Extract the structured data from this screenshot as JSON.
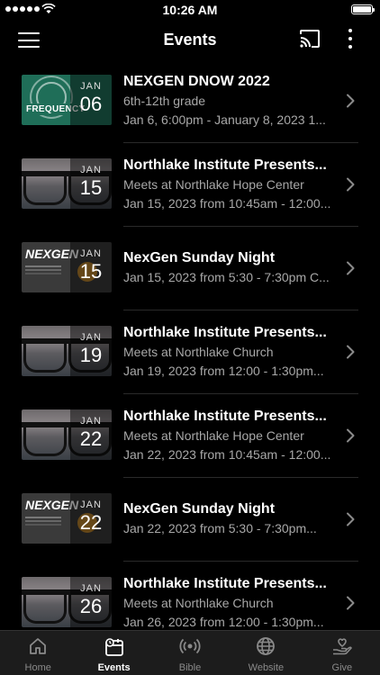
{
  "status_bar": {
    "time": "10:26 AM"
  },
  "header": {
    "title": "Events"
  },
  "events": [
    {
      "name": "NEXGEN DNOW 2022",
      "line1": "6th-12th grade",
      "line2": "Jan 6, 6:00pm - January 8, 2023 1...",
      "month": "JAN",
      "day": "06",
      "art": "frequency",
      "art_text": "FREQUENCY"
    },
    {
      "name": "Northlake Institute Presents...",
      "line1": "Meets at Northlake Hope Center",
      "line2": "Jan 15, 2023 from 10:45am - 12:00...",
      "month": "JAN",
      "day": "15",
      "art": "glasses"
    },
    {
      "name": "NexGen Sunday Night",
      "line1": "Jan 15, 2023 from 5:30 - 7:30pm C...",
      "line2": "",
      "month": "JAN",
      "day": "15",
      "art": "nexgen",
      "art_text": "NEXGEN"
    },
    {
      "name": "Northlake Institute Presents...",
      "line1": "Meets at Northlake Church",
      "line2": "Jan 19, 2023 from 12:00 - 1:30pm...",
      "month": "JAN",
      "day": "19",
      "art": "glasses"
    },
    {
      "name": "Northlake Institute Presents...",
      "line1": "Meets at Northlake Hope Center",
      "line2": "Jan 22, 2023 from 10:45am - 12:00...",
      "month": "JAN",
      "day": "22",
      "art": "glasses"
    },
    {
      "name": "NexGen Sunday Night",
      "line1": "Jan 22, 2023 from 5:30 - 7:30pm...",
      "line2": "",
      "month": "JAN",
      "day": "22",
      "art": "nexgen",
      "art_text": "NEXGEN"
    },
    {
      "name": "Northlake Institute Presents...",
      "line1": "Meets at Northlake Church",
      "line2": "Jan 26, 2023 from 12:00 - 1:30pm...",
      "month": "JAN",
      "day": "26",
      "art": "glasses"
    }
  ],
  "tabs": [
    {
      "label": "Home",
      "icon": "home-icon",
      "active": false
    },
    {
      "label": "Events",
      "icon": "calendar-icon",
      "active": true
    },
    {
      "label": "Bible",
      "icon": "broadcast-icon",
      "active": false
    },
    {
      "label": "Website",
      "icon": "globe-icon",
      "active": false
    },
    {
      "label": "Give",
      "icon": "give-icon",
      "active": false
    }
  ],
  "colors": {
    "background": "#000000",
    "tabbar": "#1c1c1c",
    "secondary_text": "#a8a8a8"
  }
}
